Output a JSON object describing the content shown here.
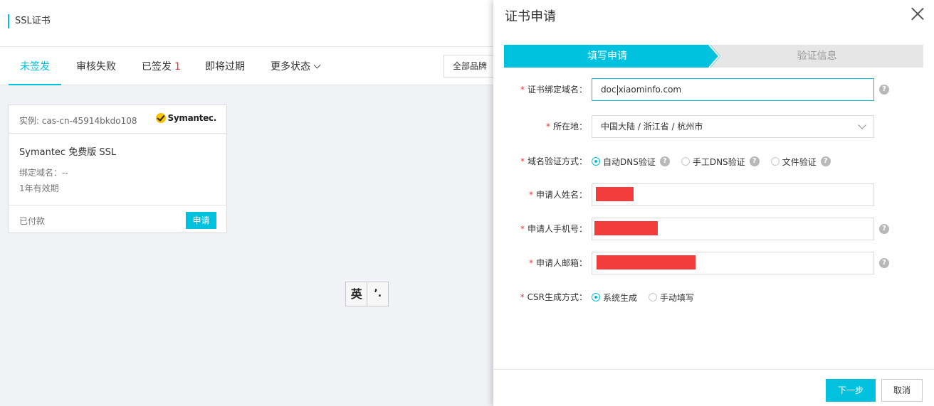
{
  "page": {
    "title": "SSL证书",
    "tabs": [
      {
        "label": "未签发"
      },
      {
        "label": "审核失败"
      },
      {
        "label": "已签发",
        "count": "1"
      },
      {
        "label": "即将过期"
      },
      {
        "label": "更多状态"
      }
    ],
    "brand_filter": "全部品牌",
    "card": {
      "instance": "实例: cas-cn-45914bkdo108",
      "brand": "Symantec.",
      "name": "Symantec 免费版 SSL",
      "domain": "绑定域名：--",
      "validity": "1年有效期",
      "status": "已付款",
      "apply_label": "申请"
    },
    "ime": {
      "mode": "英",
      "punct": "’."
    }
  },
  "drawer": {
    "title": "证书申请",
    "steps": [
      {
        "label": "填写申请",
        "active": true
      },
      {
        "label": "验证信息",
        "active": false
      }
    ],
    "fields": {
      "domain": {
        "label": "证书绑定域名：",
        "value_before_caret": "doc",
        "value_after_caret": "xiaominfo.com"
      },
      "location": {
        "label": "所在地：",
        "value": "中国大陆 / 浙江省 / 杭州市"
      },
      "verify_method": {
        "label": "域名验证方式：",
        "options": [
          {
            "label": "自动DNS验证",
            "selected": true
          },
          {
            "label": "手工DNS验证",
            "selected": false
          },
          {
            "label": "文件验证",
            "selected": false
          }
        ]
      },
      "name": {
        "label": "申请人姓名："
      },
      "phone": {
        "label": "申请人手机号："
      },
      "email": {
        "label": "申请人邮箱："
      },
      "csr": {
        "label": "CSR生成方式：",
        "options": [
          {
            "label": "系统生成",
            "selected": true
          },
          {
            "label": "手动填写",
            "selected": false
          }
        ]
      }
    },
    "required_mark": "*",
    "help_glyph": "?",
    "next_label": "下一步",
    "cancel_label": "取消"
  },
  "colors": {
    "accent": "#00c1de",
    "required": "#e4393c",
    "redaction": "#f33d3d"
  }
}
